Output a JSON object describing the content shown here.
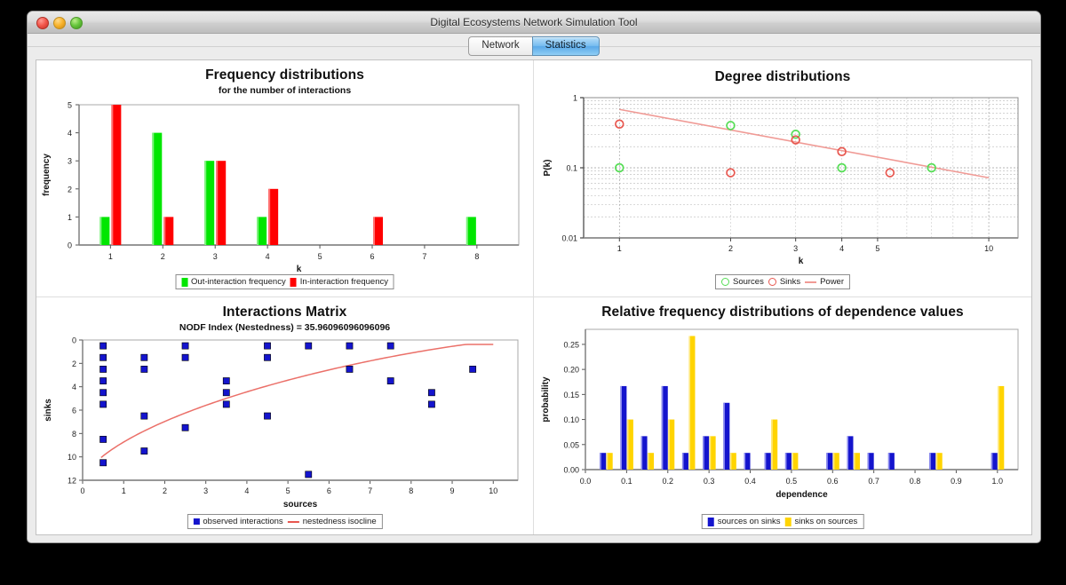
{
  "window": {
    "title": "Digital Ecosystems Network Simulation Tool",
    "controls": {
      "close": "close",
      "minimize": "minimize",
      "zoom": "zoom"
    }
  },
  "tabs": [
    {
      "label": "Network",
      "selected": false
    },
    {
      "label": "Statistics",
      "selected": true
    }
  ],
  "colors": {
    "green": "#00e600",
    "red": "#ff0000",
    "line_red": "#e8574f",
    "blue": "#1414cd",
    "yellow": "#ffd400",
    "marker_green": "#55dd55",
    "marker_red": "#e8574f"
  },
  "panels": {
    "freq": {
      "title": "Frequency distributions",
      "subtitle": "for the number of interactions",
      "legend": [
        {
          "label": "Out-interaction frequency",
          "color": "#00e600"
        },
        {
          "label": "In-interaction frequency",
          "color": "#ff0000"
        }
      ]
    },
    "degree": {
      "title": "Degree distributions",
      "legend": [
        {
          "label": "Sources",
          "color": "#55dd55",
          "kind": "circle"
        },
        {
          "label": "Sinks",
          "color": "#e8574f",
          "kind": "circle"
        },
        {
          "label": "Power",
          "color": "#f09a95",
          "kind": "line"
        }
      ]
    },
    "matrix": {
      "title": "Interactions Matrix",
      "subtitle": "NODF Index (Nestedness) = 35.96096096096096",
      "legend": [
        {
          "label": "observed interactions",
          "color": "#1414cd",
          "kind": "square"
        },
        {
          "label": "nestedness isocline",
          "color": "#e8574f",
          "kind": "line"
        }
      ]
    },
    "dependence": {
      "title": "Relative frequency distributions of dependence values",
      "legend": [
        {
          "label": "sources on sinks",
          "color": "#1414cd"
        },
        {
          "label": "sinks on sources",
          "color": "#ffd400"
        }
      ]
    }
  },
  "chart_data": [
    {
      "id": "frequency-distributions",
      "type": "bar",
      "title": "Frequency distributions",
      "subtitle": "for the number of interactions",
      "xlabel": "k",
      "ylabel": "frequency",
      "categories": [
        1,
        2,
        3,
        4,
        5,
        6,
        7,
        8
      ],
      "xticks": [
        1,
        2,
        3,
        4,
        5,
        6,
        7,
        8
      ],
      "yticks": [
        0,
        1,
        2,
        3,
        4,
        5
      ],
      "xlim": [
        0.4,
        8.8
      ],
      "ylim": [
        0,
        5
      ],
      "grid": false,
      "legend_position": "bottom",
      "series": [
        {
          "name": "Out-interaction frequency",
          "color": "#00e600",
          "values": [
            1,
            4,
            3,
            1,
            0,
            0,
            0,
            1
          ]
        },
        {
          "name": "In-interaction frequency",
          "color": "#ff0000",
          "values": [
            5,
            1,
            3,
            2,
            0,
            1,
            0,
            0
          ]
        }
      ]
    },
    {
      "id": "degree-distributions",
      "type": "scatter",
      "title": "Degree distributions",
      "xlabel": "k",
      "ylabel": "P(k)",
      "xscale": "log",
      "yscale": "log",
      "xlim": [
        0.8,
        12
      ],
      "ylim": [
        0.01,
        1
      ],
      "xticks": [
        1,
        2,
        3,
        4,
        5,
        10
      ],
      "yticks": [
        0.01,
        0.1,
        1
      ],
      "grid": true,
      "legend_position": "bottom",
      "series": [
        {
          "name": "Sources",
          "color": "#55dd55",
          "marker": "open-circle",
          "points": [
            [
              1,
              0.1
            ],
            [
              2,
              0.4
            ],
            [
              3,
              0.3
            ],
            [
              4,
              0.1
            ],
            [
              7,
              0.1
            ]
          ]
        },
        {
          "name": "Sinks",
          "color": "#e8574f",
          "marker": "open-circle",
          "points": [
            [
              1,
              0.42
            ],
            [
              2,
              0.085
            ],
            [
              3,
              0.25
            ],
            [
              4,
              0.17
            ],
            [
              5.4,
              0.085
            ]
          ]
        },
        {
          "name": "Power",
          "color": "#f09a95",
          "kind": "line",
          "points": [
            [
              1,
              0.68
            ],
            [
              10,
              0.072
            ]
          ]
        }
      ]
    },
    {
      "id": "interactions-matrix",
      "type": "scatter",
      "title": "Interactions Matrix",
      "subtitle": "NODF Index (Nestedness) = 35.96096096096096",
      "xlabel": "sources",
      "ylabel": "sinks",
      "xlim": [
        0,
        10.6
      ],
      "ylim": [
        12,
        0
      ],
      "y_inverted": true,
      "xticks": [
        0,
        1,
        2,
        3,
        4,
        5,
        6,
        7,
        8,
        9,
        10
      ],
      "yticks": [
        0,
        2,
        4,
        6,
        8,
        10,
        12
      ],
      "grid": false,
      "legend_position": "bottom",
      "series": [
        {
          "name": "observed interactions",
          "color": "#1414cd",
          "marker": "square",
          "points": [
            [
              0.5,
              0.5
            ],
            [
              0.5,
              1.5
            ],
            [
              0.5,
              2.5
            ],
            [
              0.5,
              3.5
            ],
            [
              0.5,
              4.5
            ],
            [
              0.5,
              5.5
            ],
            [
              0.5,
              8.5
            ],
            [
              0.5,
              10.5
            ],
            [
              1.5,
              1.5
            ],
            [
              1.5,
              2.5
            ],
            [
              1.5,
              6.5
            ],
            [
              1.5,
              9.5
            ],
            [
              2.5,
              0.5
            ],
            [
              2.5,
              1.5
            ],
            [
              2.5,
              7.5
            ],
            [
              3.5,
              3.5
            ],
            [
              3.5,
              4.5
            ],
            [
              3.5,
              5.5
            ],
            [
              4.5,
              0.5
            ],
            [
              4.5,
              1.5
            ],
            [
              4.5,
              6.5
            ],
            [
              5.5,
              0.5
            ],
            [
              5.5,
              11.5
            ],
            [
              6.5,
              0.5
            ],
            [
              6.5,
              2.5
            ],
            [
              7.5,
              0.5
            ],
            [
              7.5,
              3.5
            ],
            [
              8.5,
              4.5
            ],
            [
              8.5,
              5.5
            ],
            [
              9.5,
              2.5
            ]
          ]
        },
        {
          "name": "nestedness isocline",
          "color": "#e8574f",
          "kind": "line",
          "description": "concave isocline rising from (0.45, 11.7) to (10, 0.4)"
        }
      ]
    },
    {
      "id": "dependence-distributions",
      "type": "bar",
      "title": "Relative frequency distributions of dependence values",
      "xlabel": "dependence",
      "ylabel": "probability",
      "xlim": [
        0.0,
        1.05
      ],
      "ylim": [
        0.0,
        0.28
      ],
      "xticks": [
        0.0,
        0.1,
        0.2,
        0.3,
        0.4,
        0.5,
        0.6,
        0.7,
        0.8,
        0.9,
        1.0
      ],
      "yticks": [
        0.0,
        0.05,
        0.1,
        0.15,
        0.2,
        0.25
      ],
      "grid": false,
      "legend_position": "bottom",
      "series": [
        {
          "name": "sources on sinks",
          "color": "#1414cd",
          "points": [
            [
              0.05,
              0.0333
            ],
            [
              0.1,
              0.1667
            ],
            [
              0.15,
              0.0667
            ],
            [
              0.2,
              0.1667
            ],
            [
              0.25,
              0.0333
            ],
            [
              0.3,
              0.0667
            ],
            [
              0.35,
              0.1333
            ],
            [
              0.4,
              0.0333
            ],
            [
              0.45,
              0.0333
            ],
            [
              0.5,
              0.0333
            ],
            [
              0.6,
              0.0333
            ],
            [
              0.65,
              0.0667
            ],
            [
              0.7,
              0.0333
            ],
            [
              0.75,
              0.0333
            ],
            [
              0.85,
              0.0333
            ],
            [
              1.0,
              0.0333
            ]
          ]
        },
        {
          "name": "sinks on sources",
          "color": "#ffd400",
          "points": [
            [
              0.05,
              0.0333
            ],
            [
              0.1,
              0.1
            ],
            [
              0.15,
              0.0333
            ],
            [
              0.2,
              0.1
            ],
            [
              0.25,
              0.2667
            ],
            [
              0.3,
              0.0667
            ],
            [
              0.35,
              0.0333
            ],
            [
              0.45,
              0.1
            ],
            [
              0.5,
              0.0333
            ],
            [
              0.6,
              0.0333
            ],
            [
              0.65,
              0.0333
            ],
            [
              0.85,
              0.0333
            ],
            [
              1.0,
              0.1667
            ]
          ]
        }
      ]
    }
  ]
}
